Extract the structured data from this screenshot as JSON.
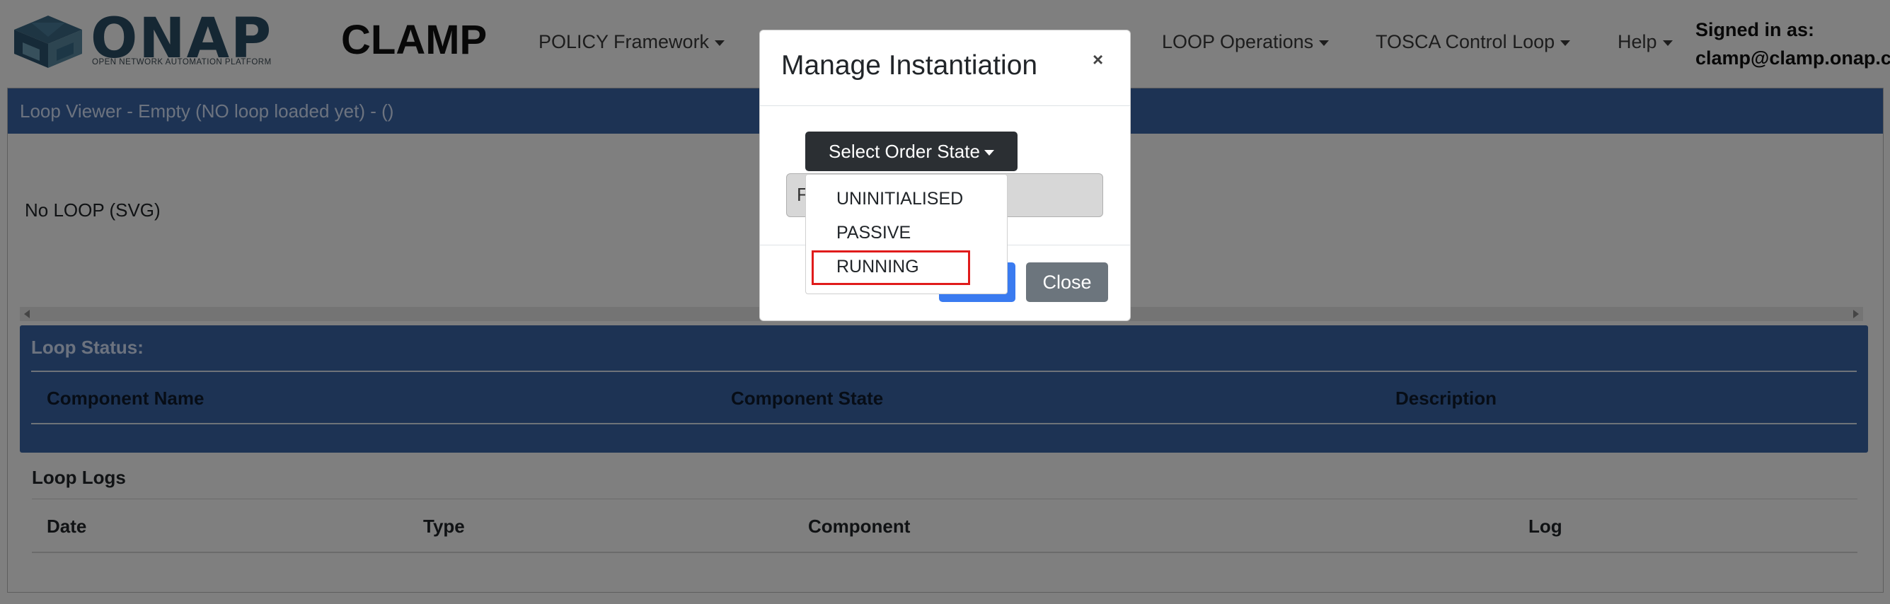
{
  "navbar": {
    "logo_word": "ONAP",
    "logo_subtitle": "OPEN NETWORK AUTOMATION PLATFORM",
    "brand": "CLAMP",
    "menus": [
      {
        "label": "POLICY Framework"
      },
      {
        "label": "LOOP Operations"
      },
      {
        "label": "TOSCA Control Loop"
      },
      {
        "label": "Help"
      }
    ],
    "signed_in_label": "Signed in as:",
    "signed_in_user": "clamp@clamp.onap.c"
  },
  "loop_viewer": {
    "header": "Loop Viewer - Empty (NO loop loaded yet) - ()",
    "svg_placeholder": "No LOOP (SVG)"
  },
  "loop_status": {
    "title": "Loop Status:",
    "columns": [
      "Component Name",
      "Component State",
      "Description"
    ]
  },
  "loop_logs": {
    "title": "Loop Logs",
    "columns": [
      "Date",
      "Type",
      "Component",
      "Log"
    ]
  },
  "modal": {
    "title": "Manage Instantiation",
    "close_symbol": "×",
    "select_label": "Select Order State",
    "input_partial": "F",
    "dropdown_options": [
      "UNINITIALISED",
      "PASSIVE",
      "RUNNING"
    ],
    "highlighted_option": "RUNNING",
    "close_button": "Close"
  },
  "colors": {
    "accent_blue": "#3a66a8",
    "highlight_red": "#e01b1b",
    "dark_button": "#2b2f33",
    "primary_button": "#3a7bf0",
    "secondary_button": "#6c757d"
  },
  "icons": [
    "onap-logo-icon",
    "chevron-down-icon",
    "close-icon",
    "scroll-left-icon",
    "scroll-right-icon"
  ]
}
